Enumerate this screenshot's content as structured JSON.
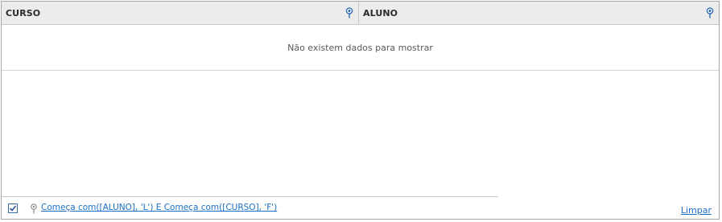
{
  "grid": {
    "columns": [
      {
        "caption": "CURSO",
        "filter_icon": "pin-filter-icon"
      },
      {
        "caption": "ALUNO",
        "filter_icon": "pin-filter-icon"
      }
    ],
    "empty_text": "Não existem dados para mostrar"
  },
  "filter_bar": {
    "enabled": true,
    "check_icon": "checkmark-icon",
    "filter_icon": "pin-filter-icon",
    "expression": "Começa com([ALUNO], 'L') E Começa com([CURSO], 'F')",
    "clear_label": "Limpar"
  },
  "colors": {
    "header_bg": "#ececec",
    "border": "#a8a8a8",
    "link": "#1a6fc4",
    "pin_blue": "#2f6db5"
  }
}
